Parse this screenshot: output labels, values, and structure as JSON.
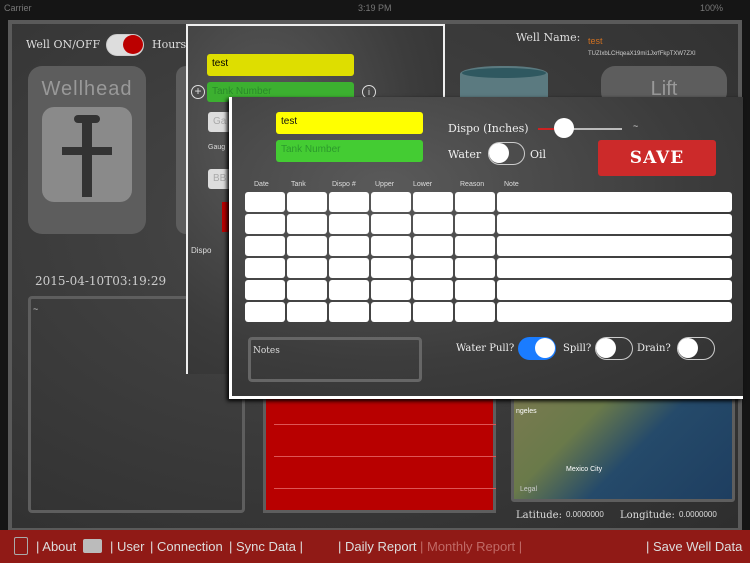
{
  "status_bar": {
    "carrier": "Carrier",
    "time": "3:19 PM",
    "battery": "100%"
  },
  "header": {
    "well_toggle_label": "Well ON/OFF",
    "hours_label": "Hours",
    "well_name_label": "Well Name:",
    "well_name_value": "test",
    "well_id": "TUZIxbLCHqeaX19mi1JxrfFkpTXW7ZXI"
  },
  "tiles": {
    "wellhead": "Wellhead",
    "lift": "Lift"
  },
  "timestamp": "2015-04-10T03:19:29",
  "left_panel_text": "~",
  "map": {
    "labels": [
      "ngeles",
      "Mexico City"
    ],
    "legal": "Legal"
  },
  "location": {
    "latitude_label": "Latitude:",
    "latitude": "0.0000000",
    "longitude_label": "Longitude:",
    "longitude": "0.0000000"
  },
  "popup_back": {
    "name_value": "test",
    "tank_placeholder": "Tank Number",
    "gauge_placeholder": "Ga",
    "gauge_label": "Gaug",
    "bbl_placeholder": "BB",
    "dispo_label": "Dispo"
  },
  "popup": {
    "name_value": "test",
    "tank_placeholder": "Tank Number",
    "dispo_label": "Dispo (Inches)",
    "dispo_value": "~",
    "dispo_slider_fraction": 0.3,
    "water_label": "Water",
    "oil_label": "Oil",
    "water_oil_on": false,
    "save_label": "SAVE",
    "columns": [
      "Date",
      "Tank",
      "Dispo #",
      "Upper",
      "Lower",
      "Reason",
      "Note"
    ],
    "row_count": 6,
    "notes_placeholder": "Notes",
    "water_pull_label": "Water Pull?",
    "water_pull_on": true,
    "spill_label": "Spill?",
    "spill_on": false,
    "drain_label": "Drain?",
    "drain_on": false
  },
  "bottom_bar": {
    "trash_icon": "trash-icon",
    "about": "| About",
    "camera_icon": "camera-icon",
    "user": "| User",
    "connection": "| Connection",
    "sync": "| Sync Data |",
    "daily": "| Daily Report",
    "monthly": "| Monthly Report |",
    "save": "| Save Well Data"
  },
  "colors": {
    "yellow": "#e6e600",
    "green": "#44cc33",
    "red": "#b50000",
    "blue": "#1a7cff",
    "bar": "#901a16"
  }
}
